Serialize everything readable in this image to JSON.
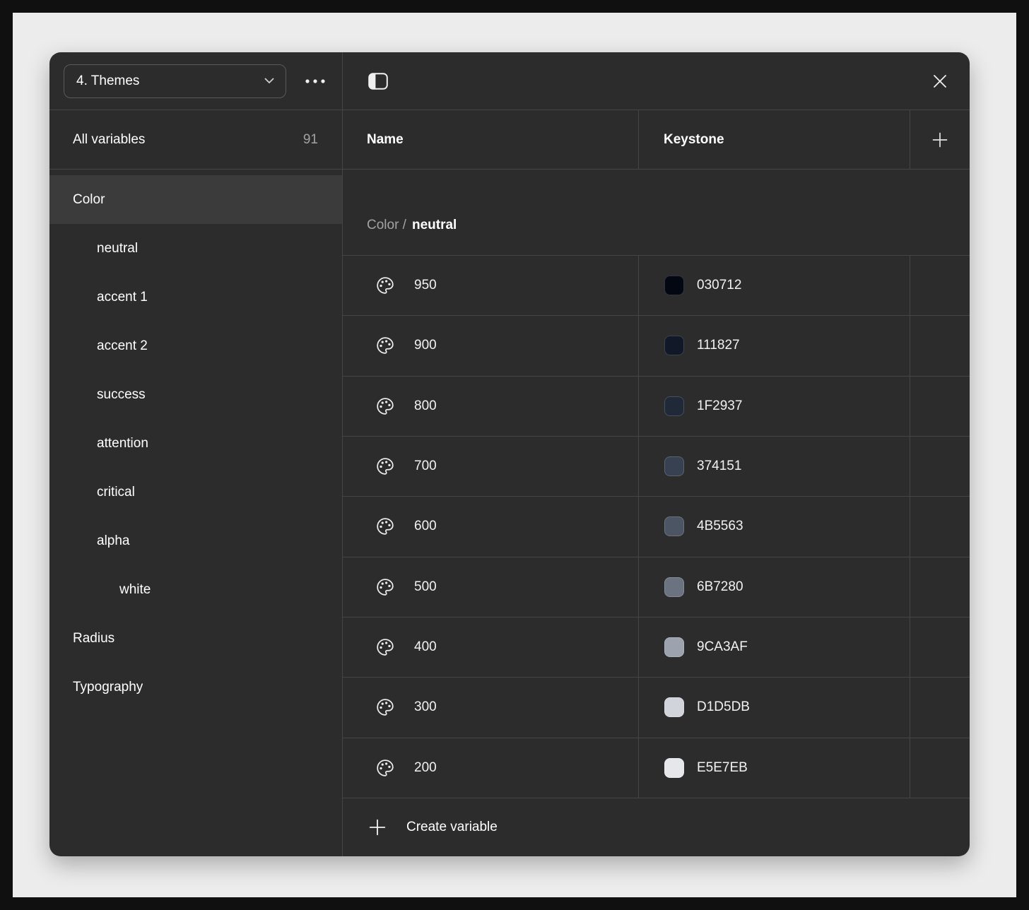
{
  "colors": {
    "panel_bg": "#2c2c2c",
    "canvas_bg": "#ececec",
    "frame_bg": "#101010",
    "selected_row_bg": "#3b3b3b",
    "divider": "rgba(255,255,255,0.12)",
    "text_primary": "#ffffff",
    "text_secondary": "#a3a3a3"
  },
  "topbar": {
    "theme_selector_label": "4. Themes"
  },
  "icons": {
    "chevron_down": "chevron-down-icon",
    "more": "more-horizontal-icon",
    "sidebar_toggle": "sidebar-toggle-icon",
    "close": "close-icon",
    "plus": "plus-icon",
    "palette": "palette-icon"
  },
  "sidebar": {
    "all_variables_label": "All variables",
    "all_variables_count": "91",
    "items": [
      {
        "label": "Color",
        "indent": 0,
        "selected": true
      },
      {
        "label": "neutral",
        "indent": 1,
        "selected": false
      },
      {
        "label": "accent 1",
        "indent": 1,
        "selected": false
      },
      {
        "label": "accent 2",
        "indent": 1,
        "selected": false
      },
      {
        "label": "success",
        "indent": 1,
        "selected": false
      },
      {
        "label": "attention",
        "indent": 1,
        "selected": false
      },
      {
        "label": "critical",
        "indent": 1,
        "selected": false
      },
      {
        "label": "alpha",
        "indent": 1,
        "selected": false
      },
      {
        "label": "white",
        "indent": 2,
        "selected": false
      },
      {
        "label": "Radius",
        "indent": 0,
        "selected": false
      },
      {
        "label": "Typography",
        "indent": 0,
        "selected": false
      }
    ]
  },
  "table": {
    "name_header": "Name",
    "keystone_header": "Keystone",
    "group_prefix": "Color /",
    "group_name": "neutral",
    "rows": [
      {
        "name": "950",
        "hex": "030712"
      },
      {
        "name": "900",
        "hex": "111827"
      },
      {
        "name": "800",
        "hex": "1F2937"
      },
      {
        "name": "700",
        "hex": "374151"
      },
      {
        "name": "600",
        "hex": "4B5563"
      },
      {
        "name": "500",
        "hex": "6B7280"
      },
      {
        "name": "400",
        "hex": "9CA3AF"
      },
      {
        "name": "300",
        "hex": "D1D5DB"
      },
      {
        "name": "200",
        "hex": "E5E7EB"
      }
    ],
    "create_variable_label": "Create variable"
  }
}
